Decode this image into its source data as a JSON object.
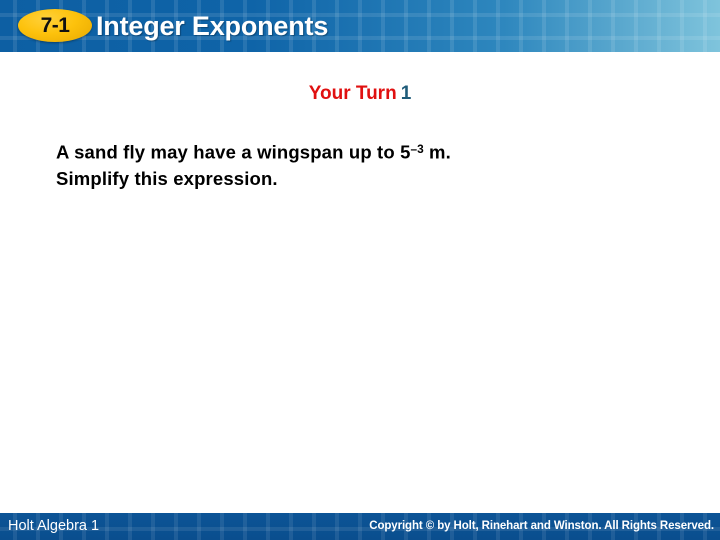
{
  "header": {
    "lesson_number": "7-1",
    "title": "Integer Exponents",
    "badge_color": "#FDC20C",
    "gradient_start": "#0D5FA3",
    "gradient_end": "#7FC4DC"
  },
  "slide": {
    "heading_label": "Your Turn",
    "heading_number": "1",
    "heading_label_color": "#E01010",
    "heading_number_color": "#1F5C7A",
    "problem_line_1_before": "A sand fly may have a wingspan up to 5",
    "problem_exponent": "–3",
    "problem_line_1_after": " m.",
    "problem_line_2": "Simplify this expression."
  },
  "footer": {
    "book_title": "Holt Algebra 1",
    "copyright": "Copyright © by Holt, Rinehart and Winston. All Rights Reserved.",
    "bar_color": "#0B5193"
  }
}
